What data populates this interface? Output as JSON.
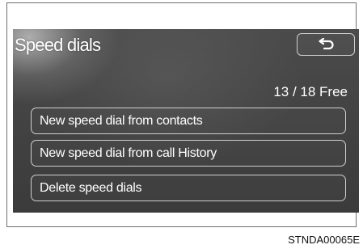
{
  "header": {
    "title": "Speed dials",
    "back_icon": "return-arrow-icon"
  },
  "status": {
    "free_count": "13 / 18 Free"
  },
  "menu": {
    "items": [
      {
        "label": "New speed dial from contacts"
      },
      {
        "label": "New speed dial from call History"
      },
      {
        "label": "Delete speed dials"
      }
    ]
  },
  "figure": {
    "code": "STNDA00065E"
  },
  "colors": {
    "screen_background": "#444444",
    "text": "#ffffff",
    "button_border": "#cfcfcf"
  }
}
